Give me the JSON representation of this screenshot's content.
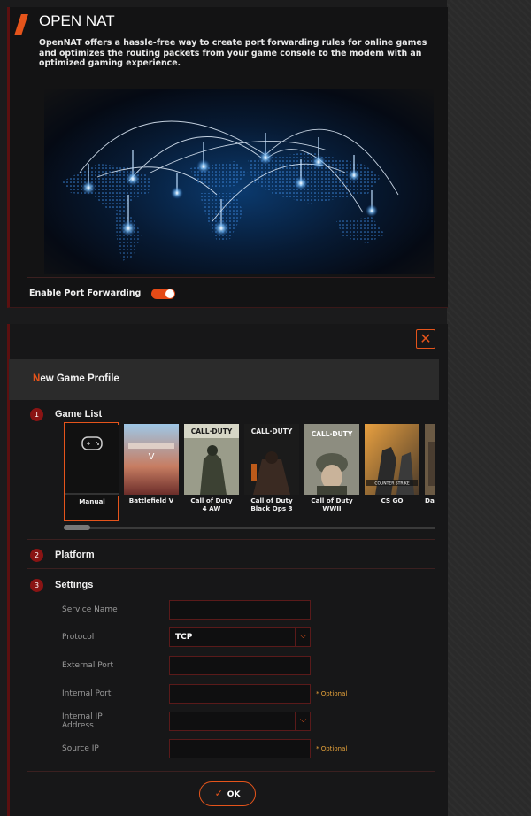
{
  "header": {
    "title": "OPEN NAT",
    "description": "OpenNAT offers a hassle-free way to create port forwarding rules for online games and optimizes the routing packets from your game console to the modem with an optimized gaming experience."
  },
  "port_forwarding": {
    "label": "Enable Port Forwarding",
    "enabled": true
  },
  "dialog": {
    "title_first_letter": "N",
    "title_rest": "ew Game Profile",
    "steps": [
      {
        "number": "1",
        "title": "Game List"
      },
      {
        "number": "2",
        "title": "Platform"
      },
      {
        "number": "3",
        "title": "Settings"
      }
    ],
    "games": [
      {
        "name": "Manual",
        "selected": true
      },
      {
        "name": "Battlefield V"
      },
      {
        "name": "Call of Duty\n4 AW"
      },
      {
        "name": "Call of Duty\nBlack Ops 3"
      },
      {
        "name": "Call of Duty\nWWII"
      },
      {
        "name": "CS GO"
      },
      {
        "name": "Da"
      }
    ],
    "settings": {
      "service_name_label": "Service Name",
      "service_name_value": "",
      "protocol_label": "Protocol",
      "protocol_value": "TCP",
      "external_port_label": "External Port",
      "external_port_value": "",
      "internal_port_label": "Internal Port",
      "internal_port_value": "",
      "internal_ip_label": "Internal IP Address",
      "internal_ip_value": "",
      "source_ip_label": "Source IP",
      "source_ip_value": "",
      "optional_text": "* Optional"
    },
    "ok_label": "OK",
    "close_icon": "close-icon"
  },
  "colors": {
    "accent": "#e5541b",
    "dark_red": "#8a1414",
    "optional": "#e5a23a"
  }
}
